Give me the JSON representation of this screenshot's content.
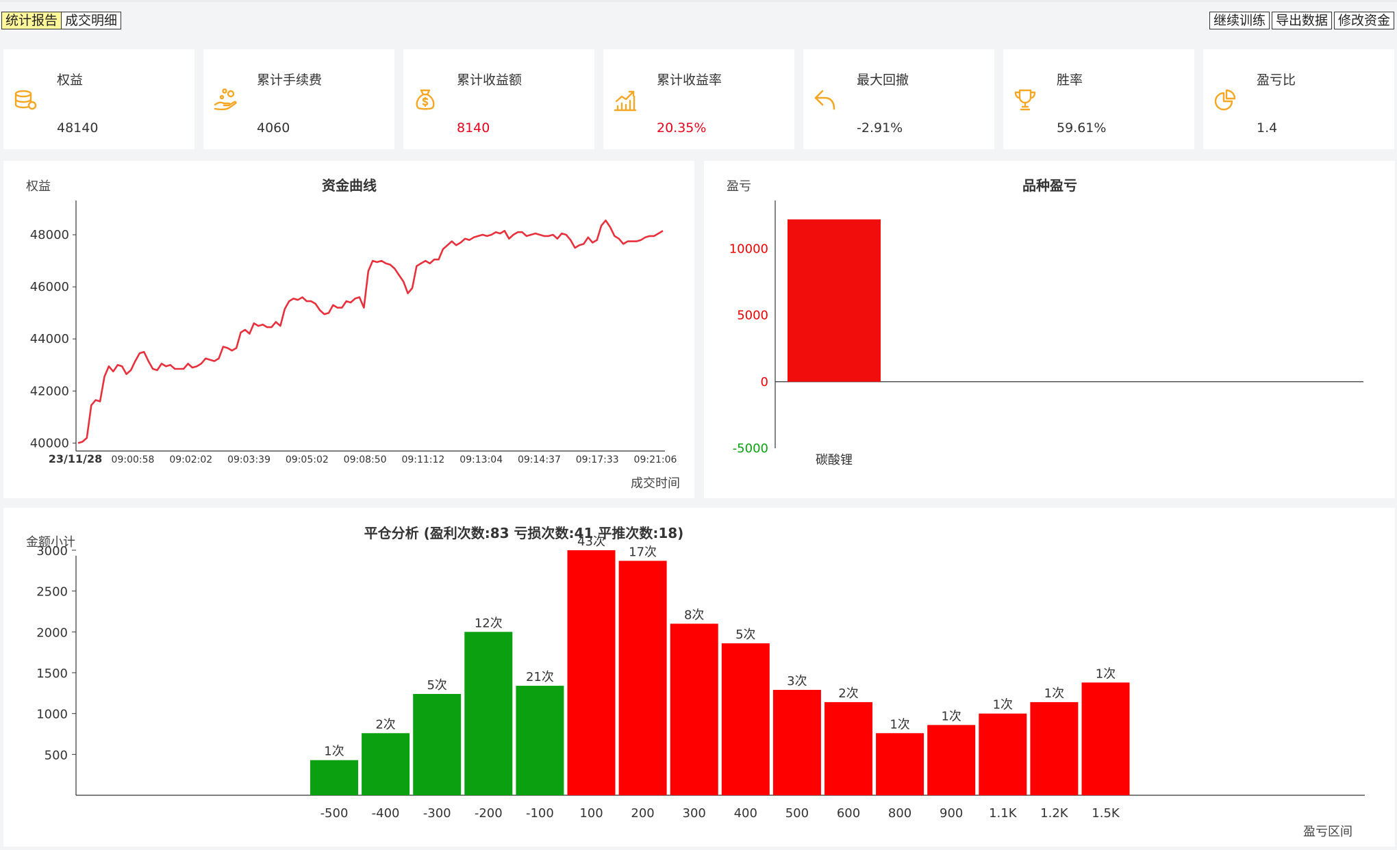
{
  "tabs": [
    {
      "label": "统计报告",
      "active": true
    },
    {
      "label": "成交明细",
      "active": false
    }
  ],
  "actions": [
    "继续训练",
    "导出数据",
    "修改资金"
  ],
  "stats": [
    {
      "label": "权益",
      "value": "48140",
      "icon": "database-coins-icon",
      "highlight": false
    },
    {
      "label": "累计手续费",
      "value": "4060",
      "icon": "hand-coins-icon",
      "highlight": false
    },
    {
      "label": "累计收益额",
      "value": "8140",
      "icon": "money-bag-icon",
      "highlight": true
    },
    {
      "label": "累计收益率",
      "value": "20.35%",
      "icon": "growth-chart-icon",
      "highlight": true
    },
    {
      "label": "最大回撤",
      "value": "-2.91%",
      "icon": "undo-arrow-icon",
      "highlight": false
    },
    {
      "label": "胜率",
      "value": "59.61%",
      "icon": "trophy-icon",
      "highlight": false
    },
    {
      "label": "盈亏比",
      "value": "1.4",
      "icon": "pie-chart-icon",
      "highlight": false
    }
  ],
  "colors": {
    "accent": "#f5a623",
    "profit": "#ff0000",
    "loss": "#0aa00f",
    "line": "#e8303c",
    "pnl_bar": "#f20d0d"
  },
  "chart_data": [
    {
      "type": "line",
      "title": "资金曲线",
      "ylabel": "权益",
      "xlabel": "成交时间",
      "date_label": "23/11/28",
      "ylim": [
        39800,
        49000
      ],
      "yticks": [
        40000,
        42000,
        44000,
        46000,
        48000
      ],
      "xticks": [
        "09:00:58",
        "09:02:02",
        "09:03:39",
        "09:05:02",
        "09:08:50",
        "09:11:12",
        "09:13:04",
        "09:14:37",
        "09:17:33",
        "09:21:06"
      ],
      "values": [
        40000,
        40050,
        40200,
        41450,
        41650,
        41600,
        42550,
        42950,
        42750,
        43000,
        42950,
        42650,
        42800,
        43150,
        43450,
        43500,
        43150,
        42850,
        42800,
        43050,
        42950,
        43000,
        42850,
        42850,
        42850,
        43050,
        42900,
        42950,
        43050,
        43250,
        43200,
        43150,
        43250,
        43700,
        43650,
        43550,
        43650,
        44250,
        44350,
        44200,
        44600,
        44500,
        44550,
        44450,
        44450,
        44650,
        44500,
        45150,
        45450,
        45550,
        45500,
        45600,
        45450,
        45450,
        45350,
        45100,
        44950,
        45000,
        45300,
        45200,
        45200,
        45450,
        45400,
        45550,
        45600,
        45200,
        46600,
        47000,
        46950,
        47000,
        46900,
        46850,
        46700,
        46450,
        46200,
        45750,
        45950,
        46800,
        46900,
        47000,
        46900,
        47050,
        47050,
        47450,
        47600,
        47750,
        47600,
        47700,
        47850,
        47800,
        47900,
        47950,
        48000,
        47950,
        48000,
        48100,
        48050,
        48150,
        47850,
        48000,
        48100,
        48100,
        47950,
        48000,
        48050,
        48000,
        47950,
        47950,
        48000,
        47850,
        48050,
        48000,
        47800,
        47500,
        47600,
        47650,
        47900,
        47700,
        47800,
        48350,
        48550,
        48300,
        47950,
        47850,
        47650,
        47750,
        47750,
        47750,
        47800,
        47900,
        47950,
        47950,
        48050,
        48150
      ]
    },
    {
      "type": "bar",
      "title": "品种盈亏",
      "ylabel": "盈亏",
      "ylim": [
        -5000,
        13000
      ],
      "yticks": [
        -5000,
        0,
        5000,
        10000
      ],
      "categories": [
        "碳酸锂"
      ],
      "values": [
        12200
      ]
    },
    {
      "type": "bar",
      "title": "平仓分析 (盈利次数:83 亏损次数:41 平推次数:18)",
      "ylabel": "金额小计",
      "xlabel": "盈亏区间",
      "ylim": [
        0,
        3100
      ],
      "yticks": [
        500,
        1000,
        1500,
        2000,
        2500,
        3000
      ],
      "categories": [
        "-500",
        "-400",
        "-300",
        "-200",
        "-100",
        "100",
        "200",
        "300",
        "400",
        "500",
        "600",
        "800",
        "900",
        "1.1K",
        "1.2K",
        "1.5K"
      ],
      "values": [
        430,
        760,
        1240,
        2000,
        1340,
        3000,
        2870,
        2100,
        1860,
        1290,
        1140,
        760,
        860,
        1000,
        1140,
        1380
      ],
      "counts": [
        "1次",
        "2次",
        "5次",
        "12次",
        "21次",
        "43次",
        "17次",
        "8次",
        "5次",
        "3次",
        "2次",
        "1次",
        "1次",
        "1次",
        "1次",
        "1次"
      ],
      "kinds": [
        "loss",
        "loss",
        "loss",
        "loss",
        "loss",
        "profit",
        "profit",
        "profit",
        "profit",
        "profit",
        "profit",
        "profit",
        "profit",
        "profit",
        "profit",
        "profit"
      ]
    }
  ]
}
